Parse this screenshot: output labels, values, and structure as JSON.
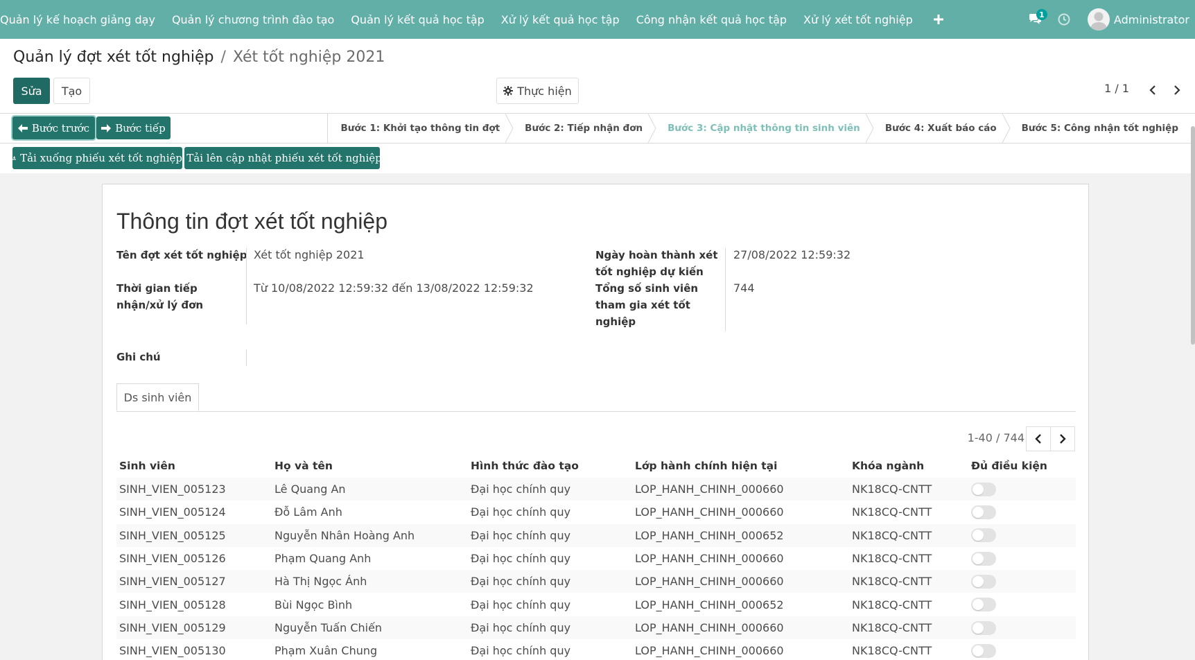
{
  "navbar": {
    "menu": [
      "Quản lý kế hoạch giảng dạy",
      "Quản lý chương trình đào tạo",
      "Quản lý kết quả học tập",
      "Xử lý kết quả học tập",
      "Công nhận kết quả học tập",
      "Xử lý xét tốt nghiệp"
    ],
    "plus_icon": "plus-icon",
    "chat_badge": "1",
    "user_name": "Administrator",
    "bg_color": "#62afa8"
  },
  "breadcrumb": {
    "parent": "Quản lý đợt xét tốt nghiệp",
    "separator": "/",
    "current": "Xét tốt nghiệp 2021"
  },
  "toolbar": {
    "edit_label": "Sửa",
    "create_label": "Tạo",
    "action_label": "Thực hiện",
    "pager": "1 / 1"
  },
  "workflow": {
    "prev_label": "Bước trước",
    "next_label": "Bước tiếp",
    "download_label": "Tải xuống phiếu xét tốt nghiệp",
    "upload_label": "Tải lên cập nhật phiếu xét tốt nghiệp",
    "steps": [
      "Bước 1: Khởi tạo thông tin đợt",
      "Bước 2: Tiếp nhận đơn",
      "Bước 3: Cập nhật thông tin sinh viên",
      "Bước 4: Xuất báo cáo",
      "Bước 5: Công nhận tốt nghiệp"
    ],
    "active_step": "Bước 3: Cập nhật thông tin sinh viên"
  },
  "form": {
    "title": "Thông tin đợt xét tốt nghiệp",
    "fields": {
      "ten_dot_label": "Tên đợt xét tốt nghiệp",
      "ten_dot_value": "Xét tốt nghiệp 2021",
      "thoi_gian_label_1": "Thời gian tiếp",
      "thoi_gian_label_2": "nhận/xử lý đơn",
      "thoi_gian_value": "Từ 10/08/2022 12:59:32 đến 13/08/2022 12:59:32",
      "ngay_hoan_thanh_label_1": "Ngày hoàn thành xét",
      "ngay_hoan_thanh_label_2": "tốt nghiệp dự kiến",
      "ngay_hoan_thanh_value": "27/08/2022 12:59:32",
      "tong_so_label_1": "Tổng số sinh viên",
      "tong_so_label_2": "tham gia xét tốt",
      "tong_so_label_3": "nghiệp",
      "tong_so_value": "744",
      "ghi_chu_label": "Ghi chú",
      "ghi_chu_value": ""
    },
    "tab_label": "Ds sinh viên",
    "list_pager": "1-40 / 744"
  },
  "table": {
    "columns": [
      "Sinh viên",
      "Họ và tên",
      "Hình thức đào tạo",
      "Lớp hành chính hiện tại",
      "Khóa ngành",
      "Đủ điều kiện"
    ],
    "rows": [
      [
        "SINH_VIEN_005123",
        "Lê Quang An",
        "Đại học chính quy",
        "LOP_HANH_CHINH_000660",
        "NK18CQ-CNTT"
      ],
      [
        "SINH_VIEN_005124",
        "Đỗ Lâm Anh",
        "Đại học chính quy",
        "LOP_HANH_CHINH_000660",
        "NK18CQ-CNTT"
      ],
      [
        "SINH_VIEN_005125",
        "Nguyễn Nhân Hoàng Anh",
        "Đại học chính quy",
        "LOP_HANH_CHINH_000652",
        "NK18CQ-CNTT"
      ],
      [
        "SINH_VIEN_005126",
        "Phạm Quang Anh",
        "Đại học chính quy",
        "LOP_HANH_CHINH_000660",
        "NK18CQ-CNTT"
      ],
      [
        "SINH_VIEN_005127",
        "Hà Thị Ngọc Ánh",
        "Đại học chính quy",
        "LOP_HANH_CHINH_000660",
        "NK18CQ-CNTT"
      ],
      [
        "SINH_VIEN_005128",
        "Bùi Ngọc Bình",
        "Đại học chính quy",
        "LOP_HANH_CHINH_000652",
        "NK18CQ-CNTT"
      ],
      [
        "SINH_VIEN_005129",
        "Nguyễn Tuấn Chiến",
        "Đại học chính quy",
        "LOP_HANH_CHINH_000660",
        "NK18CQ-CNTT"
      ],
      [
        "SINH_VIEN_005130",
        "Phạm Xuân Chung",
        "Đại học chính quy",
        "LOP_HANH_CHINH_000660",
        "NK18CQ-CNTT"
      ]
    ]
  }
}
